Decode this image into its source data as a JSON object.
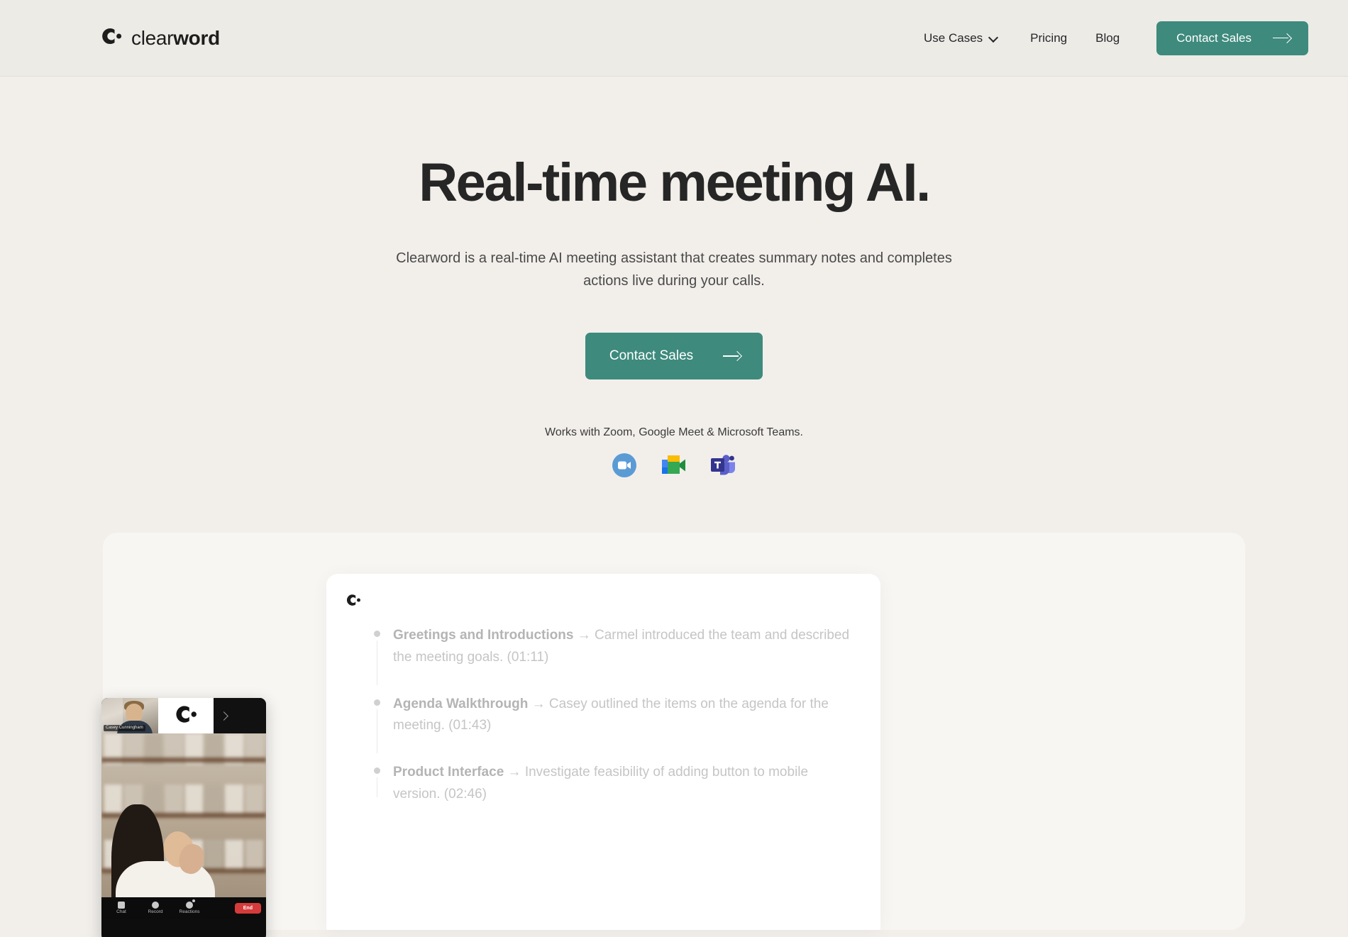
{
  "brand": {
    "name_light": "clear",
    "name_bold": "word",
    "logo_icon": "clearword-c-dot-logo"
  },
  "header": {
    "nav": [
      {
        "label": "Use Cases",
        "has_dropdown": true,
        "icon": "chevron-down-icon"
      },
      {
        "label": "Pricing",
        "has_dropdown": false
      },
      {
        "label": "Blog",
        "has_dropdown": false
      }
    ],
    "cta": {
      "label": "Contact Sales",
      "icon": "arrow-right-icon"
    }
  },
  "hero": {
    "title": "Real-time meeting AI.",
    "subtitle": "Clearword is a real-time AI meeting assistant that creates summary notes and completes actions live during your calls.",
    "cta": {
      "label": "Contact Sales",
      "icon": "arrow-right-icon"
    },
    "works_with": "Works with Zoom, Google Meet & Microsoft Teams.",
    "platforms": [
      {
        "name": "Zoom",
        "icon": "zoom-icon"
      },
      {
        "name": "Google Meet",
        "icon": "google-meet-icon"
      },
      {
        "name": "Microsoft Teams",
        "icon": "microsoft-teams-icon"
      }
    ]
  },
  "showcase": {
    "notes_logo_icon": "clearword-c-dot-logo",
    "notes": [
      {
        "topic": "Greetings and Introductions",
        "separator": "→",
        "body": "Carmel introduced the team and described the meeting goals. (01:11)",
        "timestamp": "(01:11)"
      },
      {
        "topic": "Agenda Walkthrough",
        "separator": "→",
        "body": "Casey outlined the items on the agenda for the meeting. (01:43)",
        "timestamp": "(01:43)"
      },
      {
        "topic": "Product Interface",
        "separator": "→",
        "body": "Investigate feasibility of adding button to mobile version. (02:46)",
        "timestamp": "(02:46)"
      }
    ],
    "call": {
      "participant_name": "Casey Cunningham",
      "next_icon": "chevron-right-icon",
      "tile_logo_icon": "clearword-c-dot-logo",
      "controls": [
        {
          "label": "Chat",
          "icon": "chat-icon"
        },
        {
          "label": "Record",
          "icon": "record-icon"
        },
        {
          "label": "Reactions",
          "icon": "reactions-icon"
        }
      ],
      "end_label": "End"
    }
  },
  "colors": {
    "page_background": "#f2efeb",
    "header_background": "#edebe6",
    "accent_teal": "#3e8a7d",
    "card_background": "#f8f6f2",
    "inner_card": "#ffffff",
    "end_button_red": "#d63b3b",
    "heading_text": "#262626"
  }
}
